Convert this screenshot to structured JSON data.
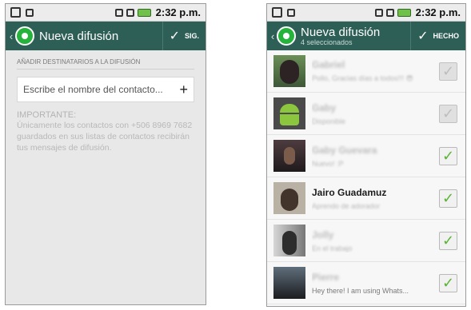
{
  "left_screen": {
    "status_time": "2:32 p.m.",
    "header_title": "Nueva difusión",
    "action_label": "SIG.",
    "section_label": "AÑADIR DESTINATARIOS A LA DIFUSIÓN",
    "recipient_placeholder": "Escribe el nombre del contacto...",
    "add_icon": "+",
    "notice_title": "IMPORTANTE:",
    "notice_body": "Únicamente los contactos con +506 8969 7682 guardados en sus listas de contactos recibirán tus mensajes de difusión."
  },
  "right_screen": {
    "status_time": "2:32 p.m.",
    "header_title": "Nueva difusión",
    "header_subtitle": "4 seleccionados",
    "action_label": "HECHO",
    "contacts": [
      {
        "name": "Gabriel",
        "status": "Pollo, Gracias días a todos!!! 😎",
        "checked": "✓",
        "selectable": false,
        "blurred": true
      },
      {
        "name": "Gaby",
        "status": "Disponible",
        "checked": "✓",
        "selectable": false,
        "blurred": true
      },
      {
        "name": "Gaby Guevara",
        "status": "Nuevo! :P",
        "checked": "✓",
        "selectable": true,
        "blurred": true
      },
      {
        "name": "Jairo Guadamuz",
        "status": "Aprendo de adorador",
        "checked": "✓",
        "selectable": true,
        "blurred": false
      },
      {
        "name": "Jolly",
        "status": "En el trabajo",
        "checked": "✓",
        "selectable": true,
        "blurred": true
      },
      {
        "name": "Pierre",
        "status": "Hey there! I am using Whats...",
        "checked": "✓",
        "selectable": true,
        "blurred": true
      }
    ]
  },
  "colors": {
    "header": "#2e5f57",
    "check": "#5bb335",
    "logo": "#25b33b"
  }
}
